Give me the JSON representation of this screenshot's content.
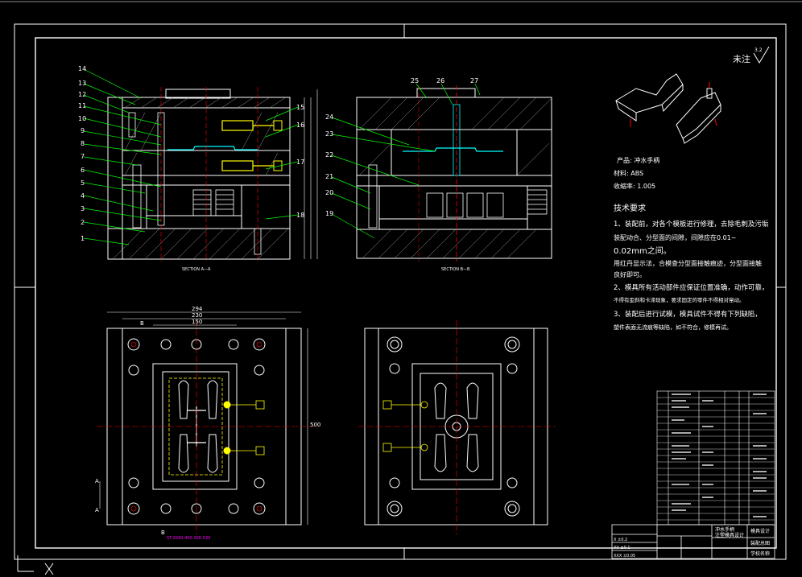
{
  "colors": {
    "background": "#000000",
    "line": "#ffffff",
    "leader": "#00ff00",
    "cyan": "#00ffff",
    "yellow": "#ffff00",
    "red": "#ff0000",
    "magenta": "#ff00ff",
    "hatch": "#a0a0a0"
  },
  "view_a": {
    "section_label": "SECTION A—A",
    "part_numbers": [
      "14",
      "13",
      "12",
      "11",
      "10",
      "9",
      "8",
      "7",
      "6",
      "5",
      "4",
      "3",
      "2",
      "1",
      "15",
      "16",
      "17",
      "18"
    ]
  },
  "view_b": {
    "section_label": "SECTION B—B",
    "part_numbers": [
      "25",
      "26",
      "27",
      "24",
      "23",
      "22",
      "21",
      "20",
      "19"
    ]
  },
  "plan_view": {
    "dim_top": [
      "294",
      "230",
      "150"
    ],
    "dim_side": "500",
    "section_marks": [
      "A",
      "A",
      "B",
      "B"
    ],
    "magenta_label": "ST-2030-450-300-530"
  },
  "notes": {
    "roughness_label": "未注",
    "roughness_value": "3.2",
    "product_line": "产品: 冲水手柄",
    "material_line": "材料: ABS",
    "shrinkage_line": "收缩率: 1.005",
    "tech_title": "技术要求",
    "req1_a": "1、装配前，对各个模板进行修理，去除毛刺及污垢",
    "req1_b": "装配动合、分型面的间隙，间隙应在0.01~",
    "req1_c": "0.02mm之间。",
    "req1_d": "用红丹显示法，合模查分型面接触痕迹，分型面接触",
    "req1_e": "良好即可。",
    "req2_a": "2、模具所有活动部件应保证位置准确，动作可靠，",
    "req2_b": "不得有歪斜和卡滞现象，要求固定的零件不得相对窜动。",
    "req3_a": "3、装配后进行试模，模具试件不得有下列缺陷，",
    "req3_b": "塑件表面无流痕等缺陷，如不符合，修模再试。"
  },
  "title_block": {
    "name_1": "冲水手柄",
    "name_2": "注塑模具设计",
    "drawing_no": "装配总图",
    "school": "模具设计",
    "school_2": "学校名称",
    "tol_rows": [
      "X  ±0.2",
      "XX ±0.1",
      "XXX ±0.05"
    ]
  }
}
